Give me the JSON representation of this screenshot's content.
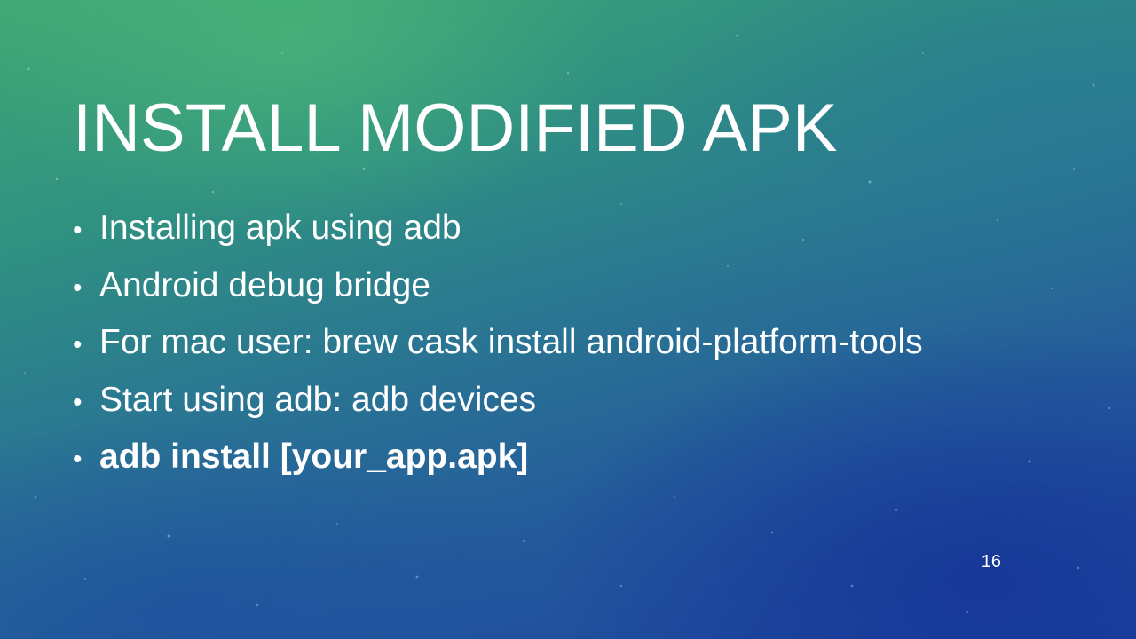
{
  "slide": {
    "title": "INSTALL MODIFIED APK",
    "bullets": [
      {
        "text": "Installing apk using adb",
        "bold": false
      },
      {
        "text": "Android debug bridge",
        "bold": false
      },
      {
        "text": "For mac user: brew cask install android-platform-tools",
        "bold": false
      },
      {
        "text": "Start using adb: adb devices",
        "bold": false
      },
      {
        "text": "adb install [your_app.apk]",
        "bold": true
      }
    ],
    "bullet_symbol": "•",
    "slide_number": "16"
  },
  "colors": {
    "text": "#ffffff",
    "background_top": "#3fa874",
    "background_bottom": "#1d43a0"
  }
}
